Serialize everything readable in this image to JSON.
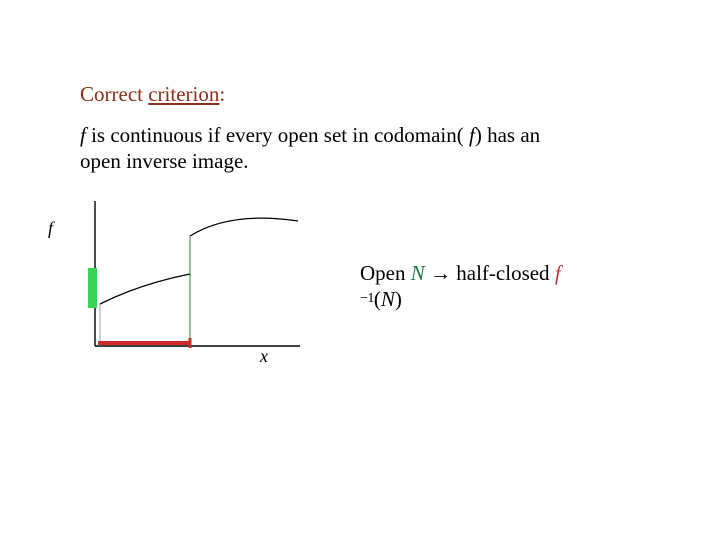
{
  "heading": {
    "prefix": "Correct ",
    "underlined": "criterion",
    "suffix": ":"
  },
  "body": {
    "f": "f",
    "rest": " is continuous if every open set in codomain( ",
    "f2": "f",
    "rest2": ") has an open inverse image."
  },
  "figure": {
    "y_label": "f",
    "x_label": "x"
  },
  "right": {
    "open_word": "Open ",
    "N": "N",
    "arrow_phrase": " → half-closed ",
    "f": "f",
    "newline_minus1": "−1",
    "open_paren": "(",
    "N2": "N",
    "close_paren": ")"
  }
}
